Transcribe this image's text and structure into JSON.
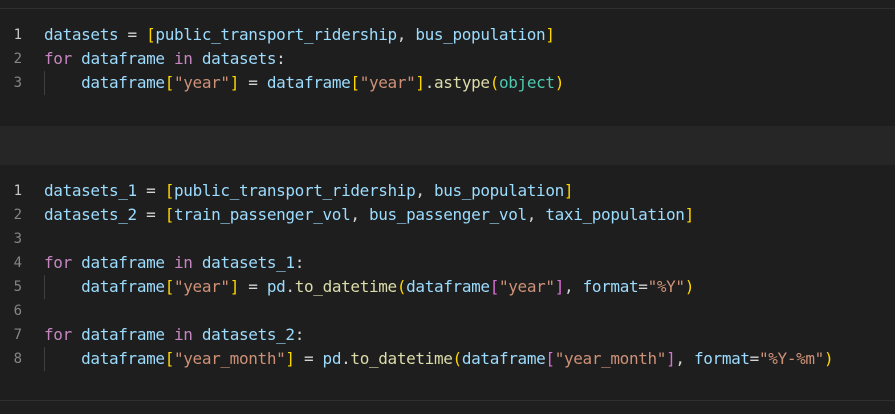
{
  "colors": {
    "background": "#1f1f1f",
    "cell_background": "#1e1e1e",
    "keyword": "#c586c0",
    "variable": "#9cdcfe",
    "string": "#ce9178",
    "function": "#dcdcaa",
    "class": "#4ec9b0",
    "bracket_level_1": "#ffd700",
    "bracket_level_2": "#da70d6",
    "line_number": "#858585"
  },
  "cells": [
    {
      "line_numbers": [
        "1",
        "2",
        "3"
      ],
      "lines": [
        [
          {
            "t": "datasets",
            "c": "var"
          },
          {
            "t": " = ",
            "c": "op"
          },
          {
            "t": "[",
            "c": "b1"
          },
          {
            "t": "public_transport_ridership",
            "c": "var"
          },
          {
            "t": ", ",
            "c": "op"
          },
          {
            "t": "bus_population",
            "c": "var"
          },
          {
            "t": "]",
            "c": "b1"
          }
        ],
        [
          {
            "t": "for",
            "c": "kw"
          },
          {
            "t": " ",
            "c": "op"
          },
          {
            "t": "dataframe",
            "c": "var"
          },
          {
            "t": " ",
            "c": "op"
          },
          {
            "t": "in",
            "c": "kw"
          },
          {
            "t": " ",
            "c": "op"
          },
          {
            "t": "datasets",
            "c": "var"
          },
          {
            "t": ":",
            "c": "op"
          }
        ],
        [
          {
            "t": "    ",
            "c": "op"
          },
          {
            "t": "dataframe",
            "c": "var"
          },
          {
            "t": "[",
            "c": "b1"
          },
          {
            "t": "\"year\"",
            "c": "str"
          },
          {
            "t": "]",
            "c": "b1"
          },
          {
            "t": " = ",
            "c": "op"
          },
          {
            "t": "dataframe",
            "c": "var"
          },
          {
            "t": "[",
            "c": "b1"
          },
          {
            "t": "\"year\"",
            "c": "str"
          },
          {
            "t": "]",
            "c": "b1"
          },
          {
            "t": ".",
            "c": "op"
          },
          {
            "t": "astype",
            "c": "fn"
          },
          {
            "t": "(",
            "c": "b1"
          },
          {
            "t": "object",
            "c": "cls"
          },
          {
            "t": ")",
            "c": "b1"
          }
        ]
      ]
    },
    {
      "line_numbers": [
        "1",
        "2",
        "3",
        "4",
        "5",
        "6",
        "7",
        "8"
      ],
      "lines": [
        [
          {
            "t": "datasets_1",
            "c": "var"
          },
          {
            "t": " = ",
            "c": "op"
          },
          {
            "t": "[",
            "c": "b1"
          },
          {
            "t": "public_transport_ridership",
            "c": "var"
          },
          {
            "t": ", ",
            "c": "op"
          },
          {
            "t": "bus_population",
            "c": "var"
          },
          {
            "t": "]",
            "c": "b1"
          }
        ],
        [
          {
            "t": "datasets_2",
            "c": "var"
          },
          {
            "t": " = ",
            "c": "op"
          },
          {
            "t": "[",
            "c": "b1"
          },
          {
            "t": "train_passenger_vol",
            "c": "var"
          },
          {
            "t": ", ",
            "c": "op"
          },
          {
            "t": "bus_passenger_vol",
            "c": "var"
          },
          {
            "t": ", ",
            "c": "op"
          },
          {
            "t": "taxi_population",
            "c": "var"
          },
          {
            "t": "]",
            "c": "b1"
          }
        ],
        [],
        [
          {
            "t": "for",
            "c": "kw"
          },
          {
            "t": " ",
            "c": "op"
          },
          {
            "t": "dataframe",
            "c": "var"
          },
          {
            "t": " ",
            "c": "op"
          },
          {
            "t": "in",
            "c": "kw"
          },
          {
            "t": " ",
            "c": "op"
          },
          {
            "t": "datasets_1",
            "c": "var"
          },
          {
            "t": ":",
            "c": "op"
          }
        ],
        [
          {
            "t": "    ",
            "c": "op"
          },
          {
            "t": "dataframe",
            "c": "var"
          },
          {
            "t": "[",
            "c": "b1"
          },
          {
            "t": "\"year\"",
            "c": "str"
          },
          {
            "t": "]",
            "c": "b1"
          },
          {
            "t": " = ",
            "c": "op"
          },
          {
            "t": "pd",
            "c": "var"
          },
          {
            "t": ".",
            "c": "op"
          },
          {
            "t": "to_datetime",
            "c": "fn"
          },
          {
            "t": "(",
            "c": "b1"
          },
          {
            "t": "dataframe",
            "c": "var"
          },
          {
            "t": "[",
            "c": "b2"
          },
          {
            "t": "\"year\"",
            "c": "str"
          },
          {
            "t": "]",
            "c": "b2"
          },
          {
            "t": ", ",
            "c": "op"
          },
          {
            "t": "format",
            "c": "var"
          },
          {
            "t": "=",
            "c": "op"
          },
          {
            "t": "\"%Y\"",
            "c": "str"
          },
          {
            "t": ")",
            "c": "b1"
          }
        ],
        [],
        [
          {
            "t": "for",
            "c": "kw"
          },
          {
            "t": " ",
            "c": "op"
          },
          {
            "t": "dataframe",
            "c": "var"
          },
          {
            "t": " ",
            "c": "op"
          },
          {
            "t": "in",
            "c": "kw"
          },
          {
            "t": " ",
            "c": "op"
          },
          {
            "t": "datasets_2",
            "c": "var"
          },
          {
            "t": ":",
            "c": "op"
          }
        ],
        [
          {
            "t": "    ",
            "c": "op"
          },
          {
            "t": "dataframe",
            "c": "var"
          },
          {
            "t": "[",
            "c": "b1"
          },
          {
            "t": "\"year_month\"",
            "c": "str"
          },
          {
            "t": "]",
            "c": "b1"
          },
          {
            "t": " = ",
            "c": "op"
          },
          {
            "t": "pd",
            "c": "var"
          },
          {
            "t": ".",
            "c": "op"
          },
          {
            "t": "to_datetime",
            "c": "fn"
          },
          {
            "t": "(",
            "c": "b1"
          },
          {
            "t": "dataframe",
            "c": "var"
          },
          {
            "t": "[",
            "c": "b2"
          },
          {
            "t": "\"year_month\"",
            "c": "str"
          },
          {
            "t": "]",
            "c": "b2"
          },
          {
            "t": ", ",
            "c": "op"
          },
          {
            "t": "format",
            "c": "var"
          },
          {
            "t": "=",
            "c": "op"
          },
          {
            "t": "\"%Y-%m\"",
            "c": "str"
          },
          {
            "t": ")",
            "c": "b1"
          }
        ]
      ]
    }
  ]
}
